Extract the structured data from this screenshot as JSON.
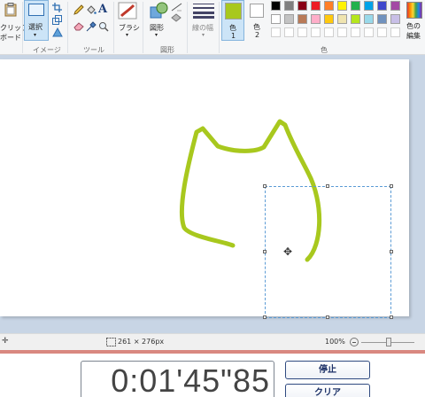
{
  "ribbon": {
    "clipboard": {
      "label_line1": "クリップ",
      "label_line2": "ボード",
      "group": ""
    },
    "image": {
      "select_label": "選択",
      "group": "イメージ"
    },
    "tools": {
      "group": "ツール"
    },
    "brush": {
      "label": "ブラシ"
    },
    "shapes": {
      "label": "図形",
      "group": "図形"
    },
    "line_width": {
      "label": "線の幅"
    },
    "color1": {
      "label_line1": "色",
      "label_line2": "1",
      "value": "#a8c81e"
    },
    "color2": {
      "label_line1": "色",
      "label_line2": "2",
      "value": "#ffffff"
    },
    "colors_group": "色",
    "edit_colors": {
      "label_line1": "色の",
      "label_line2": "編集"
    },
    "palette_row1": [
      "#000000",
      "#7f7f7f",
      "#880015",
      "#ed1c24",
      "#ff7f27",
      "#fff200",
      "#22b14c",
      "#00a2e8",
      "#3f48cc",
      "#a349a4"
    ],
    "palette_row2": [
      "#ffffff",
      "#c3c3c3",
      "#b97a57",
      "#ffaec9",
      "#ffc90e",
      "#efe4b0",
      "#b5e61d",
      "#99d9ea",
      "#7092be",
      "#c8bfe7"
    ]
  },
  "drawing": {
    "stroke_color": "#a8c81e"
  },
  "status": {
    "selection_size": "261 × 276px",
    "zoom": "100%"
  },
  "timer": {
    "display": "0:01'45\"85",
    "stop_label": "停止",
    "clear_label": "クリア"
  }
}
